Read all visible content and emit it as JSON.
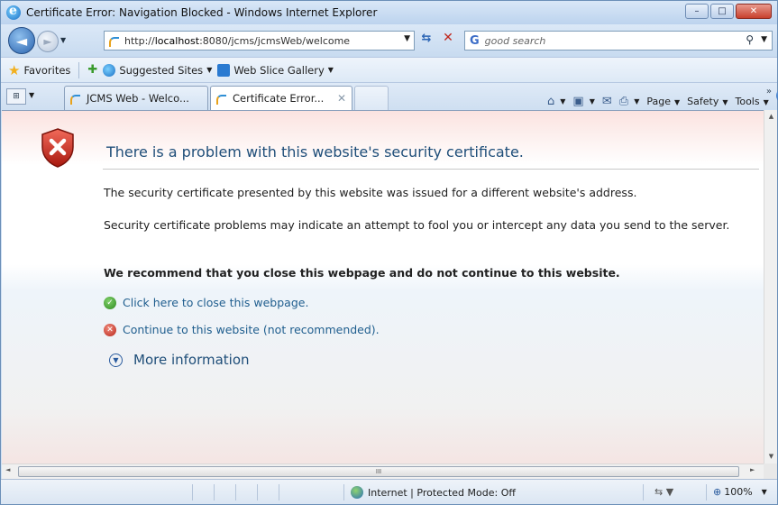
{
  "window": {
    "title": "Certificate Error: Navigation Blocked - Windows Internet Explorer",
    "controls": {
      "minimize": "–",
      "maximize": "□",
      "close": "✕"
    }
  },
  "navigation": {
    "back_glyph": "◄",
    "forward_glyph": "►",
    "address": {
      "prefix": "http://",
      "host": "localhost",
      "rest": ":8080/jcms/jcmsWeb/welcome"
    },
    "search": {
      "engine_icon": "G",
      "placeholder": "good search"
    }
  },
  "favorites_bar": {
    "favorites_label": "Favorites",
    "items": [
      {
        "label": "Suggested Sites",
        "icon": "ie-icon"
      },
      {
        "label": "Web Slice Gallery",
        "icon": "web-slice-icon"
      }
    ]
  },
  "tabs": [
    {
      "label": "JCMS Web - Welco...",
      "active": false
    },
    {
      "label": "Certificate Error...",
      "active": true,
      "close": "✕"
    }
  ],
  "command_bar": {
    "page": "Page",
    "safety": "Safety",
    "tools": "Tools",
    "help": "?"
  },
  "content": {
    "headline": "There is a problem with this website's security certificate.",
    "para1": "The security certificate presented by this website was issued for a different website's address.",
    "para2": "Security certificate problems may indicate an attempt to fool you or intercept any data you send to the server.",
    "recommend": "We recommend that you close this webpage and do not continue to this website.",
    "close_link": "Click here to close this webpage.",
    "continue_link": "Continue to this website (not recommended).",
    "more_info": "More information"
  },
  "hscroll_grip": "III",
  "status_bar": {
    "zone": "Internet | Protected Mode: Off",
    "zoom": "100%"
  },
  "colors": {
    "link": "#1f5e8e",
    "headline": "#1f4e79",
    "error_red": "#c0281e",
    "ok_green": "#2e8a1f"
  }
}
